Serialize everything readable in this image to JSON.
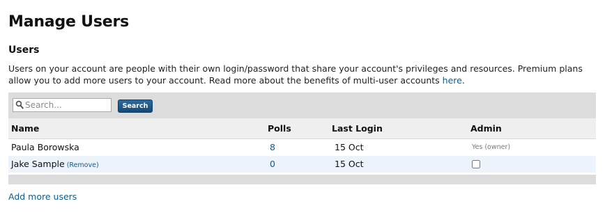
{
  "page": {
    "title": "Manage Users"
  },
  "section": {
    "title": "Users",
    "description": "Users on your account are people with their own login/password that share your account's privileges and resources. Premium plans allow you to add more users to your account. Read more about the benefits of multi-user accounts ",
    "description_link": "here",
    "description_end": "."
  },
  "search": {
    "placeholder": "Search...",
    "value": "",
    "button_label": "Search",
    "icon": "search-icon"
  },
  "table": {
    "columns": {
      "name": "Name",
      "polls": "Polls",
      "last_login": "Last Login",
      "admin": "Admin"
    },
    "rows": [
      {
        "name": "Paula Borowska",
        "polls": "8",
        "last_login": "15 Oct",
        "admin_text": "Yes (owner)"
      },
      {
        "name": "Jake Sample",
        "remove_label": "(Remove)",
        "polls": "0",
        "last_login": "15 Oct",
        "admin_checked": false
      }
    ]
  },
  "add_users": {
    "label": "Add more users"
  },
  "colors": {
    "link": "#0f5b91",
    "button": "#134a78",
    "toolbar_bg": "#dcdcdc",
    "header_bg": "#efefef",
    "alt_row_bg": "#edf3fa"
  }
}
